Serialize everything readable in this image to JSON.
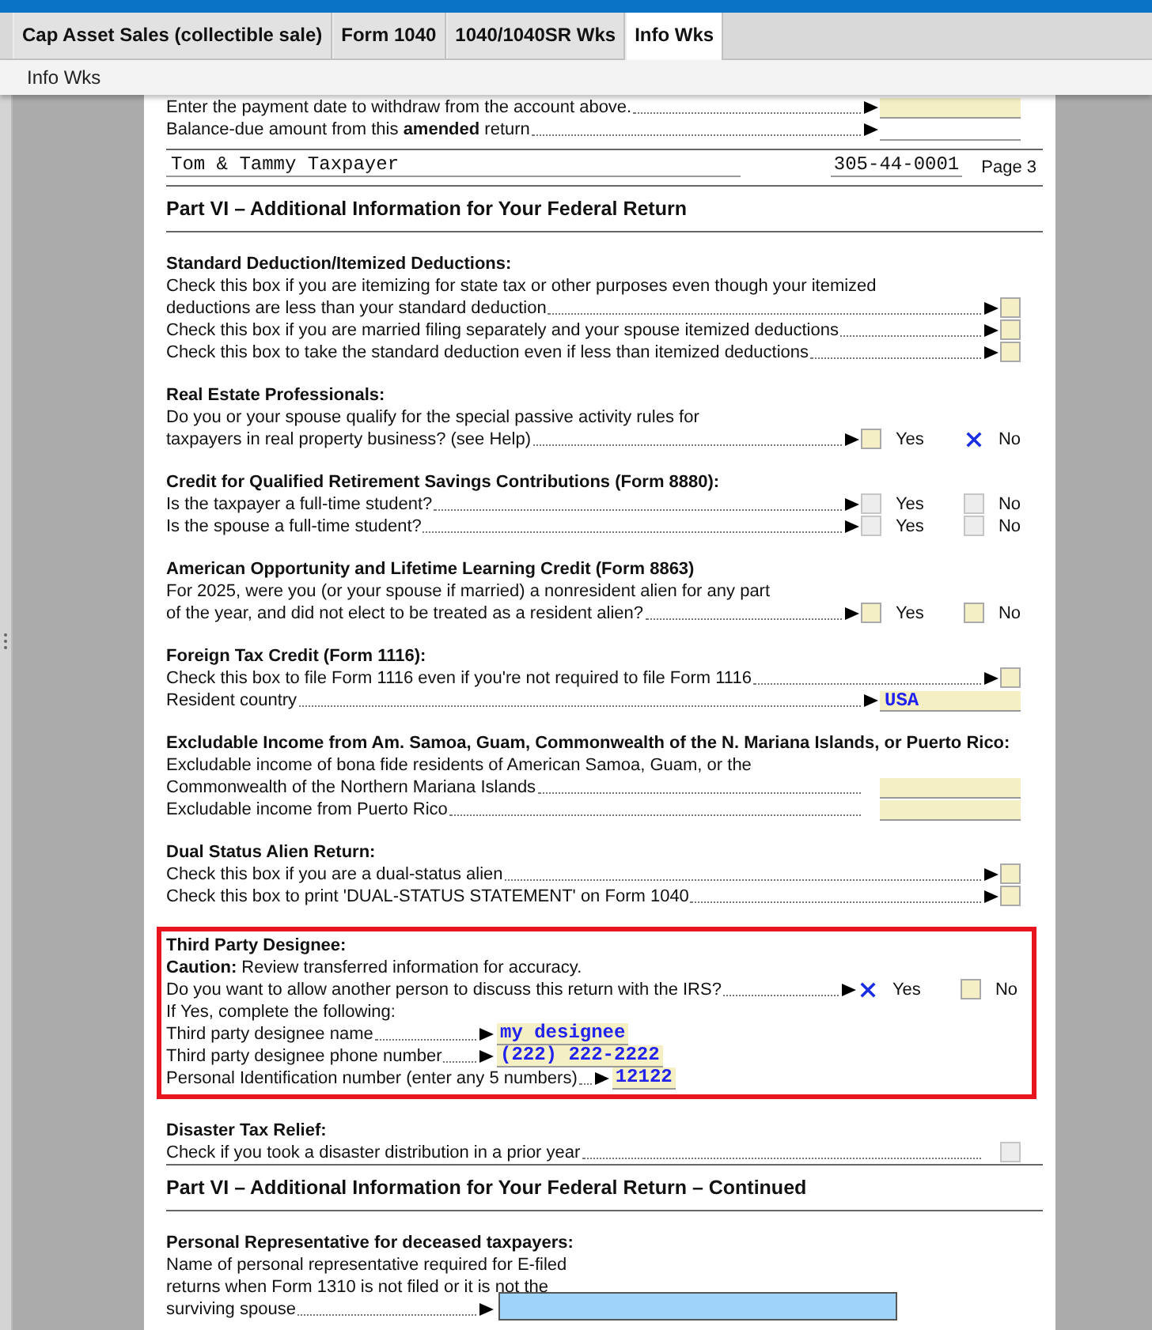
{
  "tabs": [
    {
      "label": "Cap Asset Sales (collectible sale)",
      "selected": false
    },
    {
      "label": "Form 1040",
      "selected": false
    },
    {
      "label": "1040/1040SR Wks",
      "selected": false
    },
    {
      "label": "Info Wks",
      "selected": true
    }
  ],
  "subtab": "Info Wks",
  "lines": [
    {
      "kind": "entry",
      "label": "Enter the payment date to withdraw from the account above.",
      "pointer": true,
      "highlighted": true
    },
    {
      "kind": "entry",
      "label": "Balance-due amount from this **amended** return",
      "pointer": true,
      "highlighted": false
    }
  ],
  "header": {
    "name": "Tom & Tammy Taxpayer",
    "ssn": "305-44-0001",
    "page": "Page 3"
  },
  "parts": [
    {
      "title": "Part VI – Additional Information for Your Federal Return",
      "sections": [
        {
          "title": "Standard Deduction/Itemized Deductions:",
          "highlighted": false,
          "rows": [
            {
              "kind": "text",
              "text": "Check this box if you are itemizing for state tax or other purposes even though your itemized"
            },
            {
              "kind": "check",
              "label": "deductions are less than your standard deduction",
              "pointer": true,
              "checked": false,
              "disabled": false
            },
            {
              "kind": "check",
              "label": "Check this box if you are married filing separately and your spouse itemized deductions",
              "pointer": true,
              "checked": false,
              "disabled": false
            },
            {
              "kind": "check",
              "label": "Check this box to take the standard deduction even if less than itemized deductions",
              "pointer": true,
              "checked": false,
              "disabled": false
            }
          ]
        },
        {
          "title": "Real Estate Professionals:",
          "highlighted": false,
          "rows": [
            {
              "kind": "text",
              "text": "Do you or your spouse qualify for the special passive activity rules for"
            },
            {
              "kind": "yesno",
              "label": "taxpayers in real property business? (see Help)",
              "options": [
                {
                  "label": "Yes",
                  "checked": false,
                  "disabled": false
                },
                {
                  "label": "No",
                  "checked": true,
                  "disabled": false
                }
              ]
            }
          ]
        },
        {
          "title": "Credit for Qualified Retirement Savings Contributions (Form 8880):",
          "highlighted": false,
          "rows": [
            {
              "kind": "yesno",
              "label": "Is the taxpayer a full-time student?",
              "options": [
                {
                  "label": "Yes",
                  "checked": false,
                  "disabled": true
                },
                {
                  "label": "No",
                  "checked": false,
                  "disabled": true
                }
              ]
            },
            {
              "kind": "yesno",
              "label": "Is the spouse a full-time student?",
              "options": [
                {
                  "label": "Yes",
                  "checked": false,
                  "disabled": true
                },
                {
                  "label": "No",
                  "checked": false,
                  "disabled": true
                }
              ]
            }
          ]
        },
        {
          "title": "American Opportunity and Lifetime Learning Credit  (Form 8863)",
          "highlighted": false,
          "rows": [
            {
              "kind": "text",
              "text": "For 2025, were you (or your spouse if married) a nonresident alien for any part"
            },
            {
              "kind": "yesno",
              "label": "of the year, and did not elect to be treated as a resident alien?",
              "options": [
                {
                  "label": "Yes",
                  "checked": false,
                  "disabled": false
                },
                {
                  "label": "No",
                  "checked": false,
                  "disabled": false
                }
              ]
            }
          ]
        },
        {
          "title": "Foreign Tax Credit (Form 1116):",
          "highlighted": false,
          "rows": [
            {
              "kind": "check",
              "label": "Check this box to file Form 1116 even if you're not required to file Form 1116",
              "pointer": true,
              "checked": false,
              "disabled": false
            },
            {
              "kind": "entry",
              "label": "Resident country",
              "pointer": true,
              "highlighted": true,
              "value": "USA"
            }
          ]
        },
        {
          "title": "Excludable Income  from Am. Samoa, Guam, Commonwealth of the N.  Mariana Islands, or Puerto Rico:",
          "highlighted": false,
          "rows": [
            {
              "kind": "text",
              "text": "Excludable income of bona fide residents of American Samoa, Guam, or the"
            },
            {
              "kind": "entry",
              "label": "Commonwealth of the Northern Mariana Islands",
              "pointer": false,
              "highlighted": true
            },
            {
              "kind": "entry",
              "label": "Excludable income from Puerto Rico",
              "pointer": false,
              "highlighted": true
            }
          ]
        },
        {
          "title": "Dual Status Alien Return:",
          "highlighted": false,
          "rows": [
            {
              "kind": "check",
              "label": "Check this box if you are a dual-status alien",
              "pointer": true,
              "checked": false,
              "disabled": false
            },
            {
              "kind": "check",
              "label": "Check this box to print 'DUAL-STATUS STATEMENT' on Form 1040",
              "pointer": true,
              "checked": false,
              "disabled": false
            }
          ]
        },
        {
          "title": "Third Party Designee:",
          "highlighted": true,
          "rows": [
            {
              "kind": "text",
              "text": "**Caution:** Review transferred information for accuracy."
            },
            {
              "kind": "yesno",
              "label": "Do you want to allow another person to discuss this return with the IRS?",
              "options": [
                {
                  "label": "Yes",
                  "checked": true,
                  "disabled": false
                },
                {
                  "label": "No",
                  "checked": false,
                  "disabled": false
                }
              ]
            },
            {
              "kind": "text",
              "text": "If Yes, complete the following:"
            },
            {
              "kind": "inline",
              "label": "Third party designee name",
              "value": "my designee"
            },
            {
              "kind": "inline",
              "label": "Third party designee phone number",
              "value": "(222) 222-2222"
            },
            {
              "kind": "inline",
              "label": "Personal Identification number (enter any 5 numbers)",
              "value": "12122"
            }
          ]
        },
        {
          "title": "Disaster Tax Relief:",
          "highlighted": false,
          "rows": [
            {
              "kind": "check",
              "label": "Check if you took a disaster distribution in a prior year",
              "pointer": false,
              "checked": false,
              "disabled": true
            }
          ]
        }
      ]
    },
    {
      "title": "Part VI – Additional Information for Your Federal Return – Continued",
      "sections": [
        {
          "title": "Personal Representative for deceased taxpayers:",
          "highlighted": false,
          "rows": [
            {
              "kind": "text",
              "text": "Name of personal representative required for E-filed"
            },
            {
              "kind": "text",
              "text": "returns when Form 1310 is not filed or it is not the"
            },
            {
              "kind": "inline",
              "label": "surviving spouse",
              "focused": true
            }
          ]
        }
      ]
    }
  ]
}
